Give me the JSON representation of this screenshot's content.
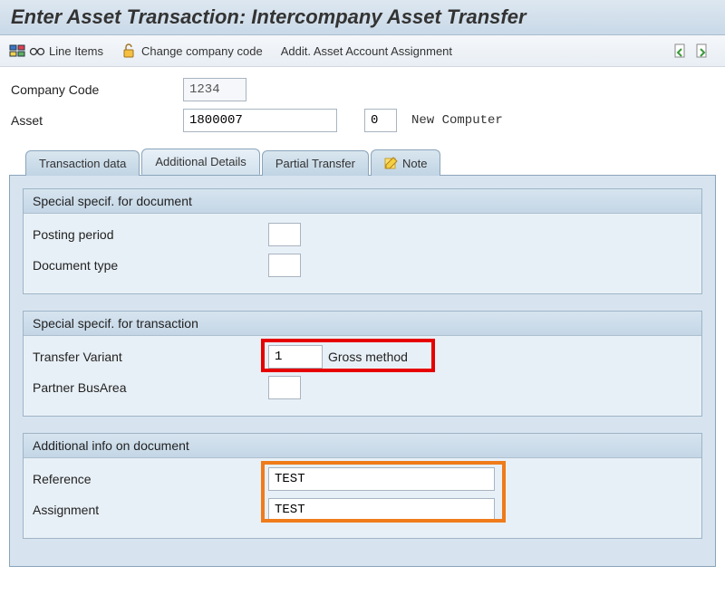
{
  "title": "Enter Asset Transaction: Intercompany Asset Transfer",
  "toolbar": {
    "line_items": "Line Items",
    "change_cc": "Change company code",
    "addit_assign": "Addit. Asset Account Assignment"
  },
  "header": {
    "company_code_label": "Company Code",
    "company_code": "1234",
    "asset_label": "Asset",
    "asset": "1800007",
    "asset_sub": "0",
    "asset_desc": "New Computer"
  },
  "tabs": {
    "t1": "Transaction data",
    "t2": "Additional Details",
    "t3": "Partial Transfer",
    "t4": "Note"
  },
  "groups": {
    "g1": {
      "title": "Special specif. for document",
      "posting_period_label": "Posting period",
      "posting_period": "",
      "doc_type_label": "Document type",
      "doc_type": ""
    },
    "g2": {
      "title": "Special specif. for transaction",
      "transfer_variant_label": "Transfer Variant",
      "transfer_variant": "1",
      "transfer_variant_text": "Gross method",
      "partner_ba_label": "Partner BusArea",
      "partner_ba": ""
    },
    "g3": {
      "title": "Additional info on document",
      "reference_label": "Reference",
      "reference": "TEST",
      "assignment_label": "Assignment",
      "assignment": "TEST"
    }
  }
}
